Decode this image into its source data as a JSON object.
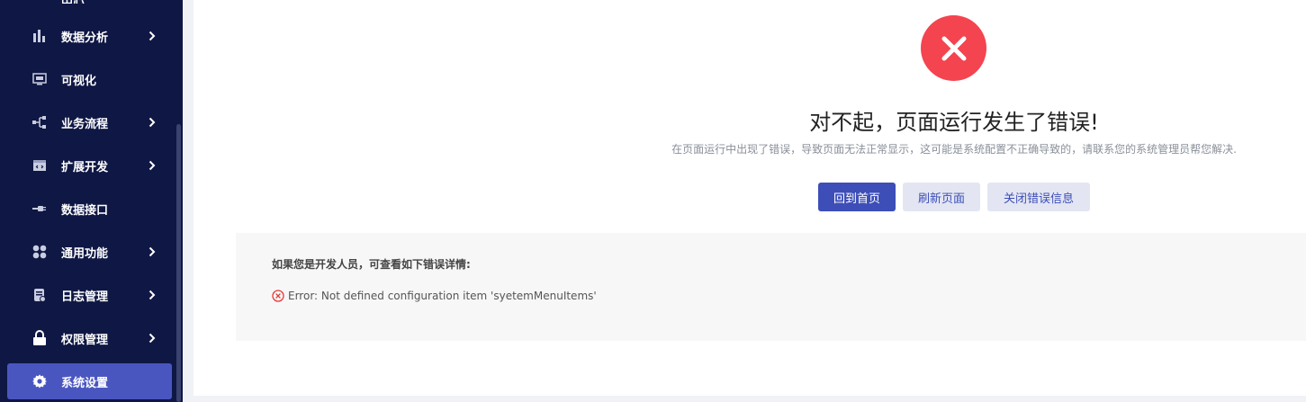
{
  "sidebar": {
    "partial_top_label": "中心",
    "items": [
      {
        "label": "数据分析",
        "icon": "bar-chart-icon",
        "has_children": true
      },
      {
        "label": "可视化",
        "icon": "monitor-icon",
        "has_children": false
      },
      {
        "label": "业务流程",
        "icon": "flow-icon",
        "has_children": true
      },
      {
        "label": "扩展开发",
        "icon": "code-icon",
        "has_children": true
      },
      {
        "label": "数据接口",
        "icon": "plug-icon",
        "has_children": false
      },
      {
        "label": "通用功能",
        "icon": "grid-icon",
        "has_children": true
      },
      {
        "label": "日志管理",
        "icon": "log-icon",
        "has_children": true
      },
      {
        "label": "权限管理",
        "icon": "lock-icon",
        "has_children": true
      },
      {
        "label": "系统设置",
        "icon": "gear-icon",
        "has_children": false,
        "active": true
      }
    ]
  },
  "error": {
    "icon": "close-icon",
    "title": "对不起，页面运行发生了错误!",
    "subtitle": "在页面运行中出现了错误，导致页面无法正常显示，这可能是系统配置不正确导致的，请联系您的系统管理员帮您解决.",
    "buttons": {
      "home": "回到首页",
      "refresh": "刷新页面",
      "close": "关闭错误信息"
    },
    "details": {
      "hint": "如果您是开发人员，可查看如下错误详情:",
      "message": "Error: Not defined configuration item 'syetemMenuItems'"
    }
  },
  "colors": {
    "sidebar_bg": "#0f1744",
    "active_item": "#4a56c0",
    "error_red": "#f4444f",
    "primary": "#3d4eb8"
  }
}
